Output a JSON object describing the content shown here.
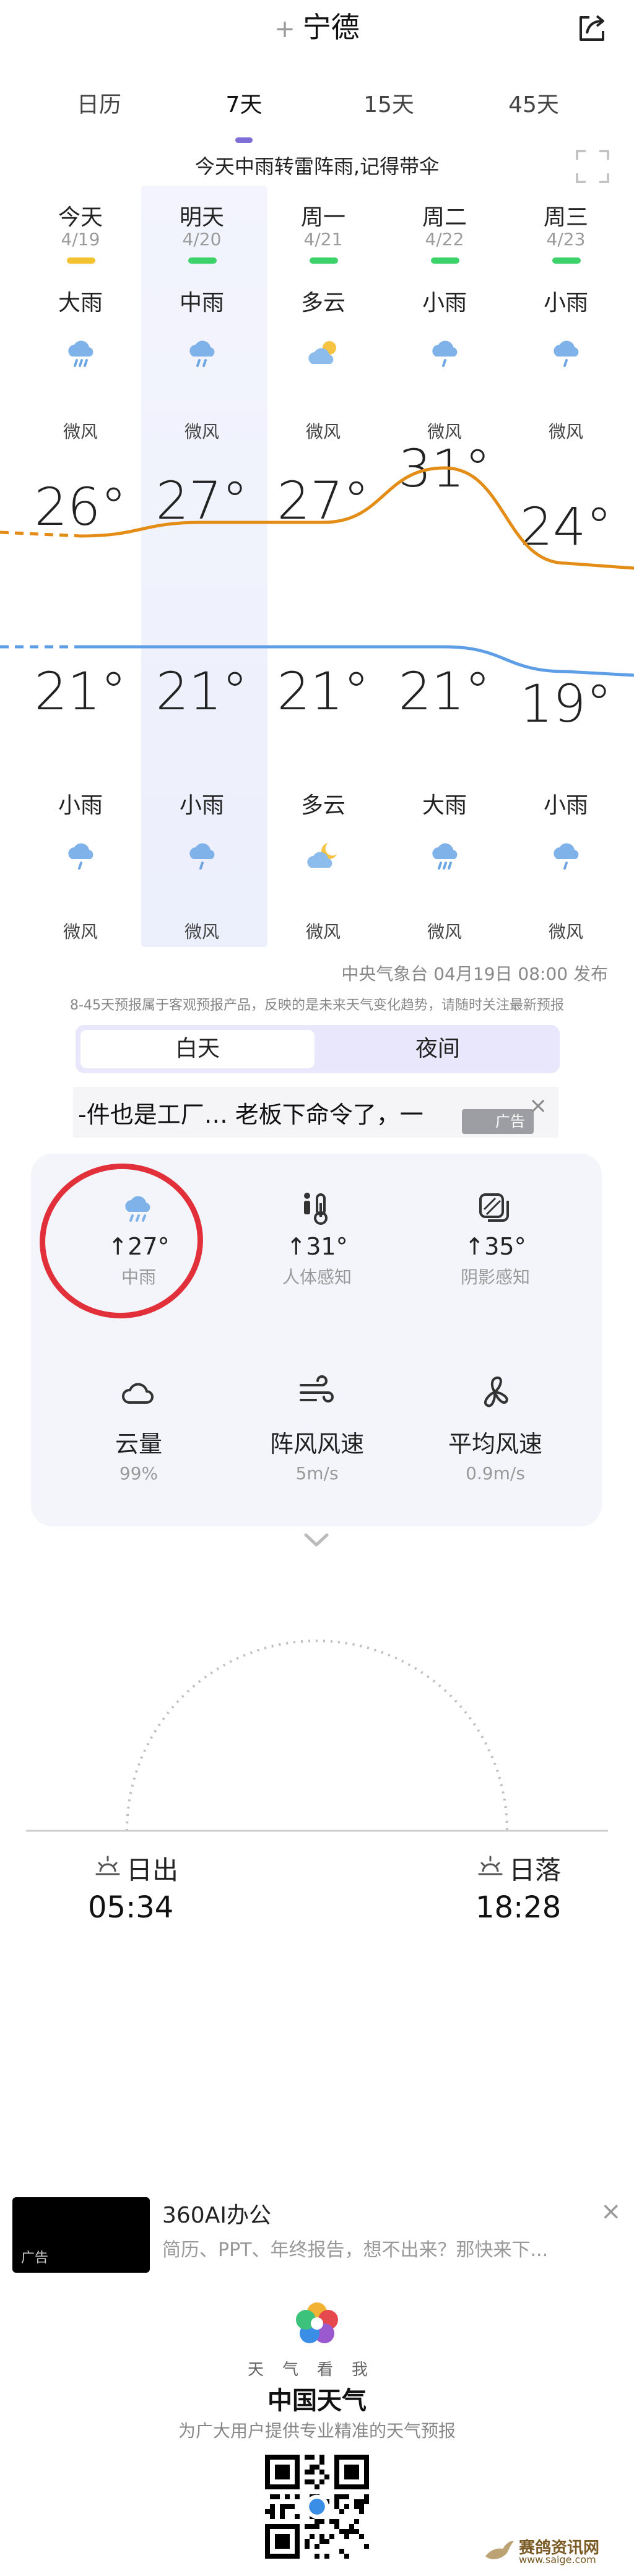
{
  "header": {
    "plus": "+",
    "city": "宁德",
    "share_icon": "share-icon"
  },
  "tabs": [
    "日历",
    "7天",
    "15天",
    "45天"
  ],
  "summary": "今天中雨转雷阵雨,记得带伞",
  "days": [
    {
      "name": "今天",
      "date": "4/19",
      "aqi_color": "#f2c230",
      "day_cond": "大雨",
      "day_icon": "heavy-rain-icon",
      "day_wind": "微风",
      "high": "26°",
      "low": "21°",
      "night_cond": "小雨",
      "night_icon": "light-rain-icon",
      "night_wind": "微风"
    },
    {
      "name": "明天",
      "date": "4/20",
      "aqi_color": "#3bd26a",
      "day_cond": "中雨",
      "day_icon": "moderate-rain-icon",
      "day_wind": "微风",
      "high": "27°",
      "low": "21°",
      "night_cond": "小雨",
      "night_icon": "light-rain-icon",
      "night_wind": "微风"
    },
    {
      "name": "周一",
      "date": "4/21",
      "aqi_color": "#3bd26a",
      "day_cond": "多云",
      "day_icon": "partly-cloudy-icon",
      "day_wind": "微风",
      "high": "27°",
      "low": "21°",
      "night_cond": "多云",
      "night_icon": "cloudy-night-icon",
      "night_wind": "微风"
    },
    {
      "name": "周二",
      "date": "4/22",
      "aqi_color": "#3bd26a",
      "day_cond": "小雨",
      "day_icon": "light-rain-icon",
      "day_wind": "微风",
      "high": "31°",
      "low": "21°",
      "night_cond": "大雨",
      "night_icon": "heavy-rain-icon",
      "night_wind": "微风"
    },
    {
      "name": "周三",
      "date": "4/23",
      "aqi_color": "#3bd26a",
      "day_cond": "小雨",
      "day_icon": "light-rain-icon",
      "day_wind": "微风",
      "high": "24°",
      "low": "19°",
      "night_cond": "小雨",
      "night_icon": "light-rain-icon",
      "night_wind": "微风"
    }
  ],
  "colors": {
    "high_line": "#e38c16",
    "low_line": "#5d9ee6",
    "accent": "#7e6fd6"
  },
  "source": "中央气象台 04月19日 08:00 发布",
  "disclaimer": "8-45天预报属于客观预报产品，反映的是未来天气变化趋势，请随时关注最新预报",
  "daynight": {
    "day": "白天",
    "night": "夜间"
  },
  "ad1": {
    "text": "-件也是工厂… 老板下命令了，一",
    "badge": "广告",
    "close": "×"
  },
  "details": [
    {
      "icon": "rain-icon",
      "value": "↑27°",
      "label": "中雨"
    },
    {
      "icon": "thermometer-icon",
      "value": "↑31°",
      "label": "人体感知"
    },
    {
      "icon": "shade-icon",
      "value": "↑35°",
      "label": "阴影感知"
    },
    {
      "icon": "cloud-icon",
      "value": "云量",
      "label": "99%"
    },
    {
      "icon": "gust-icon",
      "value": "阵风风速",
      "label": "5m/s"
    },
    {
      "icon": "fan-icon",
      "value": "平均风速",
      "label": "0.9m/s"
    }
  ],
  "sun": {
    "rise_label": "日出",
    "rise_time": "05:34",
    "set_label": "日落",
    "set_time": "18:28"
  },
  "ad2": {
    "title": "360AI办公",
    "desc": "简历、PPT、年终报告，想不出来？那快来下...",
    "badge": "广告",
    "close": "×"
  },
  "brand": {
    "sub": "天气看我",
    "name": "中国天气",
    "slogan": "为广大用户提供专业精准的天气预报"
  },
  "watermark": {
    "name": "赛鸽资讯网",
    "url": "www.saige.com"
  }
}
